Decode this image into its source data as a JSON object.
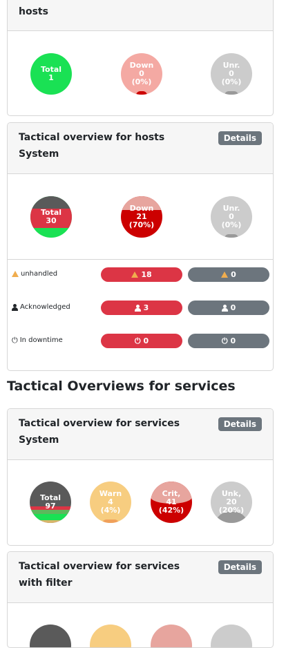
{
  "card1": {
    "title": "hosts",
    "circles": [
      {
        "label": "Total",
        "value": "1"
      },
      {
        "label": "Down",
        "value": "0",
        "pct": "(0%)"
      },
      {
        "label": "Unr.",
        "value": "0",
        "pct": "(0%)"
      }
    ]
  },
  "card2": {
    "title_line1": "Tactical overview for hosts",
    "title_line2": "System",
    "details_label": "Details",
    "circles": [
      {
        "label": "Total",
        "value": "30"
      },
      {
        "label": "Down",
        "value": "21",
        "pct": "(70%)"
      },
      {
        "label": "Unr.",
        "value": "0",
        "pct": "(0%)"
      }
    ],
    "rows": [
      {
        "label": "unhandled",
        "icon": "warning-icon",
        "down": "18",
        "unreachable": "0"
      },
      {
        "label": "Acknowledged",
        "icon": "user-icon",
        "down": "3",
        "unreachable": "0"
      },
      {
        "label": "In downtime",
        "icon": "power-icon",
        "down": "0",
        "unreachable": "0"
      }
    ]
  },
  "services_section_title": "Tactical Overviews for services",
  "card3": {
    "title_line1": "Tactical overview for services",
    "title_line2": "System",
    "details_label": "Details",
    "circles": [
      {
        "label": "Total",
        "value": "97"
      },
      {
        "label": "Warn",
        "value": "4",
        "pct": "(4%)"
      },
      {
        "label": "Crit,",
        "value": "41",
        "pct": "(42%)"
      },
      {
        "label": "Unk,",
        "value": "20",
        "pct": "(20%)"
      }
    ]
  },
  "card4": {
    "title_line1": "Tactical overview for services",
    "title_line2": "with filter",
    "details_label": "Details"
  },
  "colors": {
    "ok": "#1ae154",
    "critical": "#cc0000",
    "down_light": "#f4a9a3",
    "unreachable": "#cccccc",
    "warning": "#f7cd80",
    "badge_red": "#dc3545",
    "badge_grey": "#6c757d"
  }
}
